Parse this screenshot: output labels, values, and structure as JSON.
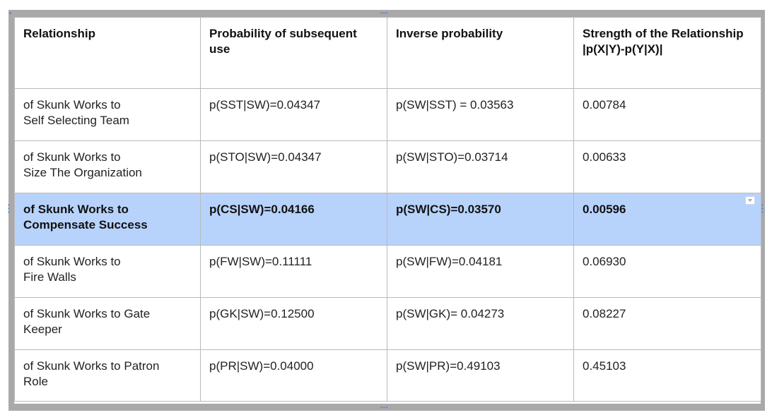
{
  "table": {
    "headers": [
      "Relationship",
      "Probability of subsequent use",
      "Inverse probability",
      "Strength of the Relationship\n|p(X|Y)-p(Y|X)|"
    ],
    "rows": [
      [
        "of Skunk Works to\nSelf Selecting Team",
        "p(SST|SW)=0.04347",
        "p(SW|SST) = 0.03563",
        "0.00784"
      ],
      [
        "of Skunk Works to\nSize The Organization",
        "p(STO|SW)=0.04347",
        "p(SW|STO)=0.03714",
        "0.00633"
      ],
      [
        "of Skunk Works to\nCompensate Success",
        "p(CS|SW)=0.04166",
        "p(SW|CS)=0.03570",
        "0.00596"
      ],
      [
        "of Skunk Works to\nFire Walls",
        "p(FW|SW)=0.11111",
        "p(SW|FW)=0.04181",
        "0.06930"
      ],
      [
        "of Skunk Works to Gate\nKeeper",
        "p(GK|SW)=0.12500",
        "p(SW|GK)= 0.04273",
        "0.08227"
      ],
      [
        "of Skunk Works to Patron\nRole",
        "p(PR|SW)=0.04000",
        "p(SW|PR)=0.49103",
        "0.45103"
      ]
    ],
    "selected_row_index": 2
  },
  "colors": {
    "selection": "#b8d3fb",
    "frame": "#a9a9a9",
    "handle": "#5b7fd1"
  },
  "icons": {
    "resize_handles": "dots-handle-icon",
    "row_menu": "chevron-down-icon"
  }
}
